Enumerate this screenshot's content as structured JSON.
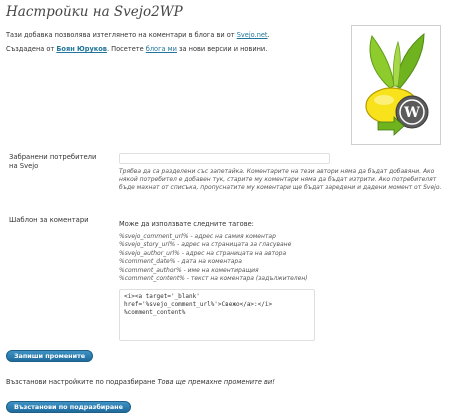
{
  "page": {
    "title": "Настройки на Svejo2WP"
  },
  "intro": {
    "line1_prefix": "Тази добавка позволява изтеглянето на коментари в блога ви от ",
    "line1_link": "Svejo.net",
    "line1_suffix": ".",
    "line2_prefix": "Създадена от ",
    "line2_author": "Боян Юруков",
    "line2_middle": ". Посетете ",
    "line2_link": "блога ми",
    "line2_suffix": " за нови версии и новини."
  },
  "logo": {
    "icon": "lemon-wordpress-logo",
    "colors": {
      "lemon": "#f5e020",
      "leaf": "#7fc225",
      "wp": "#555555"
    }
  },
  "blocked_users": {
    "label": "Забранени потребители на Svejo",
    "value": "",
    "hint": "Трябва да са разделени със запетайка. Коментарите на тези автори няма да бъдат добавяни. Ако някой потребител е добавен тук, старите му коментари няма да бъдат изтрити. Ако потребителят бъде махнат от списъка, пропуснатите му коментари ще бъдат заредени и дадени момент от Svejo."
  },
  "template": {
    "label": "Шаблон за коментари",
    "tags_title": "Може да използвате следните тагове:",
    "tags": [
      "%svejo_comment_url% - адрес на самия коментар",
      "%svejo_story_url% - адрес на страницата за гласуване",
      "%svejo_author_url% - адрес на страницата на автора",
      "%comment_date% - дата на коментара",
      "%comment_author% - име на коментиращия",
      "%comment_content% - текст на коментара (задължителен)"
    ],
    "line1": "<i><a target='_blank'",
    "line2": "href='%svejo_comment_url%'>Свежо</a>:</i>",
    "line3": "%comment_content%"
  },
  "buttons": {
    "save": "Запиши промените",
    "reset": "Възстанови по подразбиране"
  },
  "reset_note": {
    "text": "Възстанови настройките по подразбиране ",
    "emphasis": "Това ще премахне промените ви!"
  }
}
